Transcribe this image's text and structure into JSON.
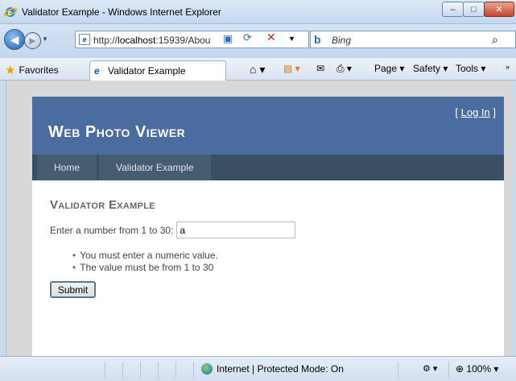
{
  "window": {
    "title": "Validator Example - Windows Internet Explorer",
    "minimize": "–",
    "maximize": "□",
    "close": "✕"
  },
  "address": {
    "url_prefix": "http://",
    "url_host": "localhost",
    "url_rest": ":15939/Abou",
    "search_placeholder": "Bing"
  },
  "favorites": {
    "favorites_label": "Favorites",
    "tab_label": "Validator Example",
    "page_label": "Page ▾",
    "safety_label": "Safety ▾",
    "tools_label": "Tools ▾"
  },
  "site": {
    "title": "Web Photo Viewer",
    "login_open": "[ ",
    "login_link": "Log In",
    "login_close": " ]",
    "nav": [
      "Home",
      "Validator Example"
    ]
  },
  "page": {
    "heading": "Validator Example",
    "prompt": "Enter a number from 1 to 30:",
    "input_value": "a",
    "errors": [
      "You must enter a numeric value.",
      "The value must be from 1 to 30"
    ],
    "submit_label": "Submit"
  },
  "status": {
    "zone": "Internet | Protected Mode: On",
    "zoom": "100%"
  }
}
